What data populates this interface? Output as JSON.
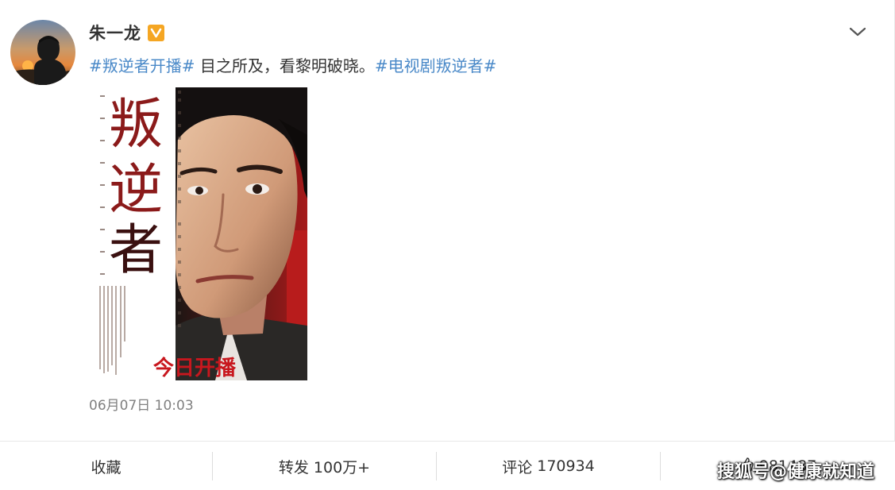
{
  "user": {
    "name": "朱一龙",
    "verified_badge": "V",
    "verified_color": "#f5a623",
    "avatar_icon": "avatar-sunset-silhouette"
  },
  "post": {
    "hashtag_1": "#叛逆者开播#",
    "text": " 目之所及，看黎明破晓。",
    "hashtag_2": "#电视剧叛逆者#",
    "hashtag_color": "#4a89c8",
    "timestamp": "06月07日 10:03"
  },
  "poster": {
    "title_1": "叛",
    "title_2": "逆",
    "title_3": "者",
    "banner": "今日开播",
    "title_color": "#8b1a1a",
    "banner_color": "#c8171e"
  },
  "actions": {
    "favorite_label": "收藏",
    "repost_label": "转发",
    "repost_count": "100万+",
    "comment_label": "评论",
    "comment_count": "170934",
    "like_count": "981487"
  },
  "watermark": "搜狐号@健康就知道"
}
